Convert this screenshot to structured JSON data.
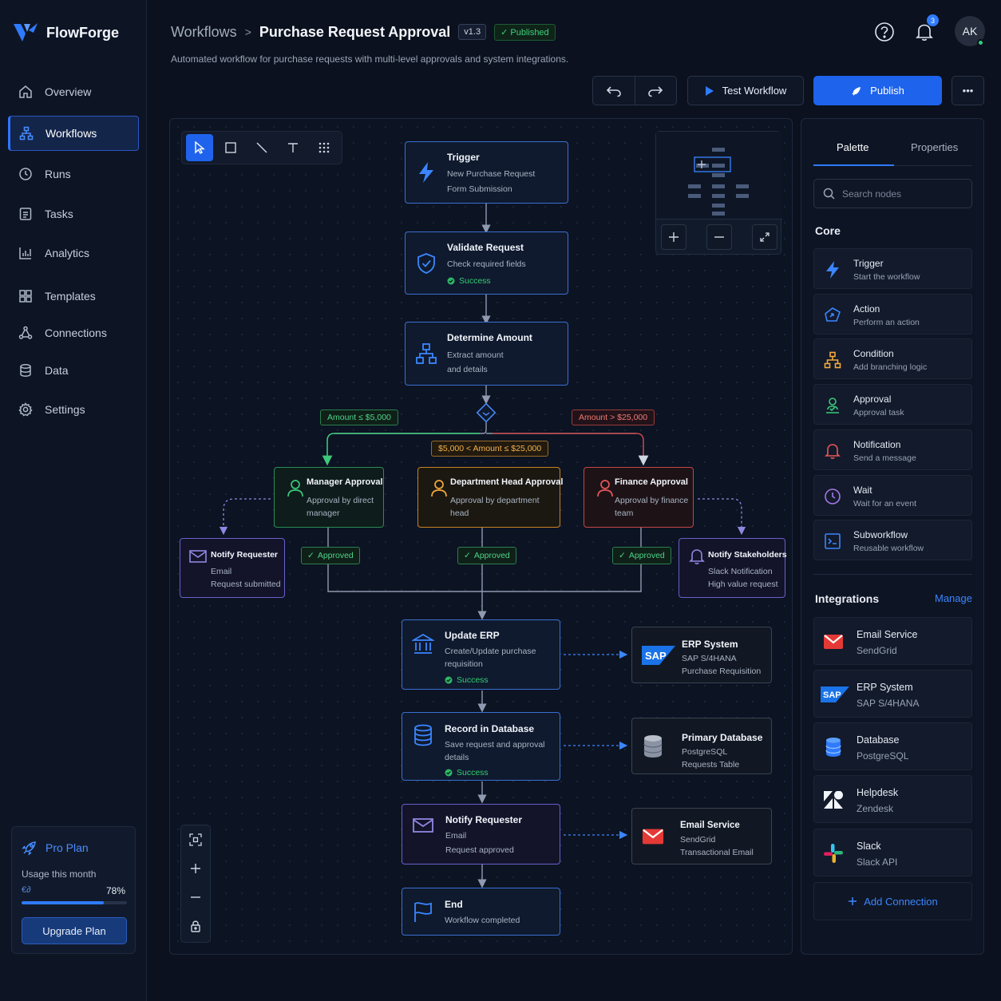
{
  "app": {
    "name": "FlowForge"
  },
  "nav": {
    "items": [
      {
        "label": "Overview",
        "icon": "home-icon"
      },
      {
        "label": "Workflows",
        "icon": "workflow-icon",
        "active": true
      },
      {
        "label": "Runs",
        "icon": "play-circle-icon"
      },
      {
        "label": "Tasks",
        "icon": "tasks-icon"
      },
      {
        "label": "Analytics",
        "icon": "analytics-icon"
      },
      {
        "label": "Templates",
        "icon": "templates-icon"
      },
      {
        "label": "Connections",
        "icon": "connections-icon"
      },
      {
        "label": "Data",
        "icon": "database-icon"
      },
      {
        "label": "Settings",
        "icon": "gear-icon"
      }
    ]
  },
  "plan": {
    "title": "Pro Plan",
    "usage_label": "Usage this month",
    "usage_sub": "€∂",
    "usage_pct": "78%",
    "usage_value": 0.78,
    "upgrade_label": "Upgrade Plan"
  },
  "header": {
    "breadcrumb_root": "Workflows",
    "separator": ">",
    "title": "Purchase Request Approval",
    "version": "v1.3",
    "status": "Published",
    "subtitle": "Automated workflow for purchase requests with multi-level approvals and system integrations.",
    "notification_count": "3",
    "avatar_initials": "AK"
  },
  "actions": {
    "test_label": "Test Workflow",
    "publish_label": "Publish",
    "more_label": "•••"
  },
  "canvas": {
    "nodes": {
      "trigger": {
        "title": "Trigger",
        "l1": "New Purchase Request",
        "l2": "Form Submission"
      },
      "validate": {
        "title": "Validate Request",
        "l1": "Check required fields",
        "status": "Success"
      },
      "determine": {
        "title": "Determine Amount",
        "l1": "Extract amount",
        "l2": "and details"
      },
      "manager": {
        "title": "Manager Approval",
        "l1": "Approval by direct",
        "l2": "manager"
      },
      "dept": {
        "title": "Department Head Approval",
        "l1": "Approval by department",
        "l2": "head"
      },
      "finance": {
        "title": "Finance Approval",
        "l1": "Approval by finance",
        "l2": "team"
      },
      "notify_req_left": {
        "title": "Notify Requester",
        "l1": "Email",
        "l2": "Request submitted"
      },
      "notify_stake": {
        "title": "Notify Stakeholders",
        "l1": "Slack Notification",
        "l2": "High value request"
      },
      "update_erp": {
        "title": "Update ERP",
        "l1": "Create/Update purchase",
        "l2": "requisition",
        "status": "Success"
      },
      "erp_system": {
        "title": "ERP System",
        "l1": "SAP S/4HANA",
        "l2": "Purchase Requisition"
      },
      "record_db": {
        "title": "Record in Database",
        "l1": "Save request and approval",
        "l2": "details",
        "status": "Success"
      },
      "primary_db": {
        "title": "Primary Database",
        "l1": "PostgreSQL",
        "l2": "Requests Table"
      },
      "notify_req": {
        "title": "Notify Requester",
        "l1": "Email",
        "l2": "Request approved"
      },
      "email_service": {
        "title": "Email Service",
        "l1": "SendGrid",
        "l2": "Transactional Email"
      },
      "end": {
        "title": "End",
        "l1": "Workflow completed"
      }
    },
    "conditions": {
      "low": "Amount ≤ $5,000",
      "high": "Amount > $25,000",
      "mid": "$5,000 < Amount ≤ $25,000"
    },
    "approved_label": "Approved"
  },
  "panel": {
    "tabs": [
      "Palette",
      "Properties"
    ],
    "search_placeholder": "Search nodes",
    "core_title": "Core",
    "core": [
      {
        "title": "Trigger",
        "sub": "Start the workflow",
        "icon": "bolt-icon"
      },
      {
        "title": "Action",
        "sub": "Perform an action",
        "icon": "action-icon"
      },
      {
        "title": "Condition",
        "sub": "Add branching logic",
        "icon": "condition-icon"
      },
      {
        "title": "Approval",
        "sub": "Approval task",
        "icon": "approval-icon"
      },
      {
        "title": "Notification",
        "sub": "Send a message",
        "icon": "bell-icon"
      },
      {
        "title": "Wait",
        "sub": "Wait for an event",
        "icon": "clock-icon"
      },
      {
        "title": "Subworkflow",
        "sub": "Reusable workflow",
        "icon": "subworkflow-icon"
      }
    ],
    "integrations_title": "Integrations",
    "manage_label": "Manage",
    "integrations": [
      {
        "title": "Email Service",
        "sub": "SendGrid",
        "icon": "gmail-icon"
      },
      {
        "title": "ERP System",
        "sub": "SAP S/4HANA",
        "icon": "sap-icon"
      },
      {
        "title": "Database",
        "sub": "PostgreSQL",
        "icon": "database-icon"
      },
      {
        "title": "Helpdesk",
        "sub": "Zendesk",
        "icon": "zendesk-icon"
      },
      {
        "title": "Slack",
        "sub": "Slack API",
        "icon": "slack-icon"
      }
    ],
    "add_connection_label": "Add Connection"
  },
  "colors": {
    "accent": "#2f7bff",
    "success": "#35cc72",
    "warning": "#f2b24d",
    "danger": "#f07a72"
  }
}
